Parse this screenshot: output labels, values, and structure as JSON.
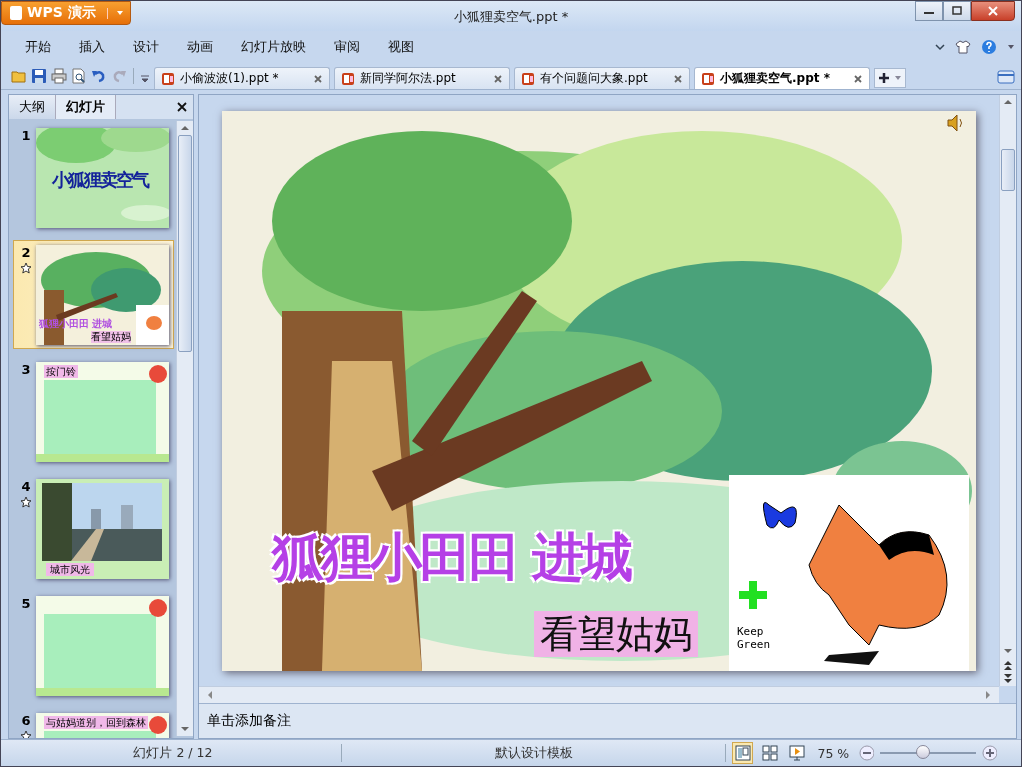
{
  "window": {
    "app_button": "WPS 演示",
    "title": "小狐狸卖空气.ppt *"
  },
  "menu": [
    "开始",
    "插入",
    "设计",
    "动画",
    "幻灯片放映",
    "审阅",
    "视图"
  ],
  "doc_tabs": [
    {
      "label": "小偷波波(1).ppt *",
      "selected": false
    },
    {
      "label": "新同学阿尔法.ppt",
      "selected": false
    },
    {
      "label": "有个问题问大象.ppt",
      "selected": false
    },
    {
      "label": "小狐狸卖空气.ppt *",
      "selected": true
    }
  ],
  "panel_tabs": [
    {
      "label": "大纲",
      "selected": false
    },
    {
      "label": "幻灯片",
      "selected": true
    }
  ],
  "thumbnails": [
    {
      "number": "1",
      "kind": "title",
      "selected": false,
      "animated": false,
      "title": "小狐狸卖空气"
    },
    {
      "number": "2",
      "kind": "tree",
      "selected": true,
      "animated": true,
      "title": "狐狸小田田 进城",
      "subtitle": "看望姑妈"
    },
    {
      "number": "3",
      "kind": "text",
      "selected": false,
      "animated": false,
      "title": "按门铃"
    },
    {
      "number": "4",
      "selected": false,
      "animated": true,
      "title": "城市风光"
    },
    {
      "number": "5",
      "kind": "text",
      "selected": false,
      "animated": false
    },
    {
      "number": "6",
      "kind": "text",
      "selected": false,
      "animated": true,
      "title": "与姑妈道别，回到森林"
    }
  ],
  "slide": {
    "title": "狐狸小田田 进城",
    "subtitle": "看望姑妈",
    "clipart_caption": "Keep Green"
  },
  "notes": {
    "placeholder": "单击添加备注"
  },
  "status_bar": {
    "slide_counter": "幻灯片 2 / 12",
    "template": "默认设计模板",
    "zoom": "75 %",
    "zoom_slider": {
      "level": 0.45
    },
    "view_buttons": [
      {
        "kind": "normal",
        "selected": true
      },
      {
        "kind": "sorter",
        "selected": false
      },
      {
        "kind": "show",
        "selected": false
      }
    ]
  }
}
